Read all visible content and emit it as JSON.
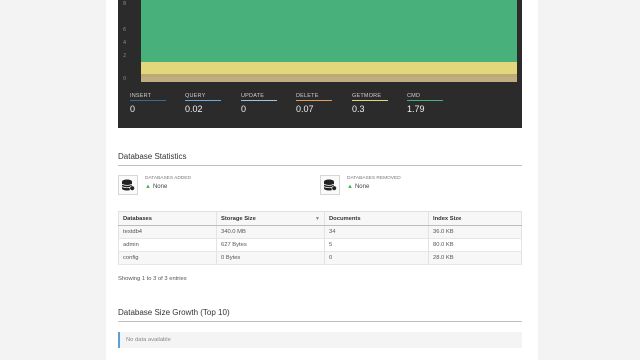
{
  "chart": {
    "y_ticks": [
      "8",
      "6",
      "4",
      "2",
      "0"
    ],
    "metrics": [
      {
        "label": "INSERT",
        "value": "0",
        "color": "#3d6a8a"
      },
      {
        "label": "QUERY",
        "value": "0.02",
        "color": "#6fa8dc"
      },
      {
        "label": "UPDATE",
        "value": "0",
        "color": "#a0c4e0"
      },
      {
        "label": "DELETE",
        "value": "0.07",
        "color": "#e39c5a"
      },
      {
        "label": "GETMORE",
        "value": "0.3",
        "color": "#e3d77c"
      },
      {
        "label": "CMD",
        "value": "1.79",
        "color": "#48b07a"
      }
    ]
  },
  "db_stats": {
    "title": "Database Statistics",
    "added": {
      "label": "DATABASES ADDED",
      "value": "None"
    },
    "removed": {
      "label": "DATABASES REMOVED",
      "value": "None"
    }
  },
  "table": {
    "headers": [
      "Databases",
      "Storage Size",
      "Documents",
      "Index Size"
    ],
    "rows": [
      [
        "testdb4",
        "340.0 MB",
        "34",
        "36.0 KB"
      ],
      [
        "admin",
        "627 Bytes",
        "5",
        "80.0 KB"
      ],
      [
        "config",
        "0 Bytes",
        "0",
        "28.0 KB"
      ]
    ],
    "footer": "Showing 1 to 3 of 3 entries"
  },
  "growth": {
    "title": "Database Size Growth (Top 10)",
    "empty": "No data available"
  }
}
